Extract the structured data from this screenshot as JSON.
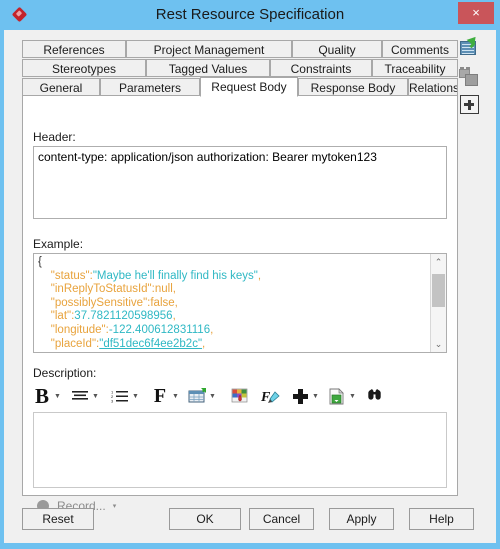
{
  "window": {
    "title": "Rest Resource Specification",
    "app_icon": "diamond-icon",
    "close_label": "×",
    "titlebar_color": "#6ec1f0",
    "close_button_color": "#c9555a"
  },
  "tabs": {
    "row1": [
      {
        "label": "References",
        "active": false
      },
      {
        "label": "Project Management",
        "active": false
      },
      {
        "label": "Quality",
        "active": false
      },
      {
        "label": "Comments",
        "active": false
      }
    ],
    "row2": [
      {
        "label": "Stereotypes",
        "active": false
      },
      {
        "label": "Tagged Values",
        "active": false
      },
      {
        "label": "Constraints",
        "active": false
      },
      {
        "label": "Traceability",
        "active": false
      }
    ],
    "row3": [
      {
        "label": "General",
        "active": false
      },
      {
        "label": "Parameters",
        "active": false
      },
      {
        "label": "Request Body",
        "active": true
      },
      {
        "label": "Response Body",
        "active": false
      },
      {
        "label": "Relations",
        "active": false
      }
    ]
  },
  "form": {
    "header": {
      "label": "Header:",
      "value": "content-type: application/json\nauthorization: Bearer mytoken123"
    },
    "example": {
      "label": "Example:",
      "lines": [
        {
          "indent": 0,
          "text": "{",
          "kind": "brace"
        },
        {
          "indent": 1,
          "key": "\"status\"",
          "value": "\"Maybe he'll finally find his keys\"",
          "value_kind": "string"
        },
        {
          "indent": 1,
          "key": "\"inReplyToStatusId\"",
          "value": "null",
          "value_kind": "literal"
        },
        {
          "indent": 1,
          "key": "\"possiblySensitive\"",
          "value": "false",
          "value_kind": "literal"
        },
        {
          "indent": 1,
          "key": "\"lat\"",
          "value": "37.7821120598956",
          "value_kind": "number"
        },
        {
          "indent": 1,
          "key": "\"longitude\"",
          "value": "-122.400612831116",
          "value_kind": "number"
        },
        {
          "indent": 1,
          "key": "\"placeId\"",
          "value": "\"df51dec6f4ee2b2c\"",
          "value_kind": "string-link"
        }
      ],
      "colors": {
        "key": "#e8a33d",
        "string": "#2fb8c4",
        "number": "#2fb8c4",
        "literal": "#e8a33d",
        "punctuation": "#e8a33d"
      },
      "scrollbar": {
        "up_arrow": "⌃",
        "down_arrow": "⌄"
      }
    },
    "description": {
      "label": "Description:",
      "value": "",
      "toolbar": [
        {
          "name": "bold-icon",
          "glyph": "B",
          "has_caret": true
        },
        {
          "name": "align-icon",
          "glyph": "align",
          "has_caret": true
        },
        {
          "name": "list-icon",
          "glyph": "list",
          "has_caret": true
        },
        {
          "name": "font-icon",
          "glyph": "F",
          "has_caret": true
        },
        {
          "name": "insert-table-icon",
          "glyph": "table",
          "has_caret": true
        },
        {
          "name": "color-palette-icon",
          "glyph": "palette",
          "has_caret": false
        },
        {
          "name": "format-painter-icon",
          "glyph": "painter",
          "has_caret": false
        },
        {
          "name": "insert-icon",
          "glyph": "plus",
          "has_caret": true
        },
        {
          "name": "document-icon",
          "glyph": "document",
          "has_caret": true
        },
        {
          "name": "find-icon",
          "glyph": "binoculars",
          "has_caret": false
        }
      ]
    },
    "record": {
      "label": "Record...",
      "caret": "▾"
    }
  },
  "right_rail": [
    {
      "name": "report-icon",
      "label": "report"
    },
    {
      "name": "component-icon",
      "label": "component"
    },
    {
      "name": "add-icon",
      "label": "add"
    }
  ],
  "buttons": {
    "reset": "Reset",
    "ok": "OK",
    "cancel": "Cancel",
    "apply": "Apply",
    "help": "Help"
  }
}
